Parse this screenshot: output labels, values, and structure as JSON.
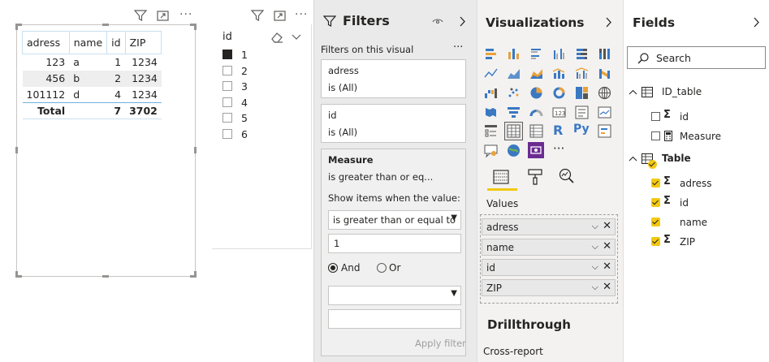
{
  "table_visual": {
    "columns": [
      "adress",
      "name",
      "id",
      "ZIP"
    ],
    "rows": [
      {
        "adress": "123",
        "name": "a",
        "id": "1",
        "zip": "1234"
      },
      {
        "adress": "456",
        "name": "b",
        "id": "2",
        "zip": "1234"
      },
      {
        "adress": "101112",
        "name": "d",
        "id": "4",
        "zip": "1234"
      }
    ],
    "total": {
      "label": "Total",
      "id": "7",
      "zip": "3702"
    }
  },
  "slicer": {
    "title": "id",
    "items": [
      {
        "label": "1",
        "checked": true
      },
      {
        "label": "2",
        "checked": false
      },
      {
        "label": "3",
        "checked": false
      },
      {
        "label": "4",
        "checked": false
      },
      {
        "label": "5",
        "checked": false
      },
      {
        "label": "6",
        "checked": false
      }
    ]
  },
  "filters": {
    "title": "Filters",
    "section_label": "Filters on this visual",
    "more": "···",
    "cards": [
      {
        "field": "adress",
        "state": "is (All)"
      },
      {
        "field": "id",
        "state": "is (All)"
      }
    ],
    "measure": {
      "field": "Measure",
      "summary": "is greater than or eq...",
      "show_items_label": "Show items when the value:",
      "condition": "is greater than or equal to",
      "value": "1",
      "and_label": "And",
      "or_label": "Or",
      "second_condition": "",
      "second_value": "",
      "apply_label": "Apply filter"
    }
  },
  "visualizations": {
    "title": "Visualizations",
    "more": "···",
    "values_label": "Values",
    "wells": [
      "adress",
      "name",
      "id",
      "ZIP"
    ],
    "drillthrough_title": "Drillthrough",
    "cross_report_label": "Cross-report"
  },
  "fields": {
    "title": "Fields",
    "search_placeholder": "Search",
    "tables": [
      {
        "name": "ID_table",
        "items": [
          {
            "name": "id"
          },
          {
            "name": "Measure"
          }
        ]
      },
      {
        "name": "Table",
        "items": [
          {
            "name": "adress"
          },
          {
            "name": "id"
          },
          {
            "name": "name"
          },
          {
            "name": "ZIP"
          }
        ]
      }
    ]
  },
  "colors": {
    "accent": "#f2c811",
    "table_header_border": "#c8e0ef",
    "total_border": "#6fb2dd",
    "pane_bg": "#f3f2f1"
  }
}
